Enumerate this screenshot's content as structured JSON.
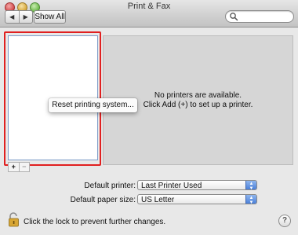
{
  "window": {
    "title": "Print & Fax"
  },
  "toolbar": {
    "back_label": "◀",
    "forward_label": "▶",
    "show_all_label": "Show All",
    "search_placeholder": ""
  },
  "detail": {
    "line1": "No printers are available.",
    "line2": "Click Add (+) to set up a printer."
  },
  "context_menu": {
    "item": "Reset printing system..."
  },
  "list_controls": {
    "add_label": "+",
    "remove_label": "−"
  },
  "settings": {
    "default_printer_label": "Default printer:",
    "default_printer_value": "Last Printer Used",
    "default_paper_label": "Default paper size:",
    "default_paper_value": "US Letter"
  },
  "footer": {
    "lock_text": "Click the lock to prevent further changes.",
    "help_label": "?"
  },
  "colors": {
    "highlight": "#e02020",
    "list_border": "#7e9cc9",
    "popup_accent": "#3e76d4"
  }
}
